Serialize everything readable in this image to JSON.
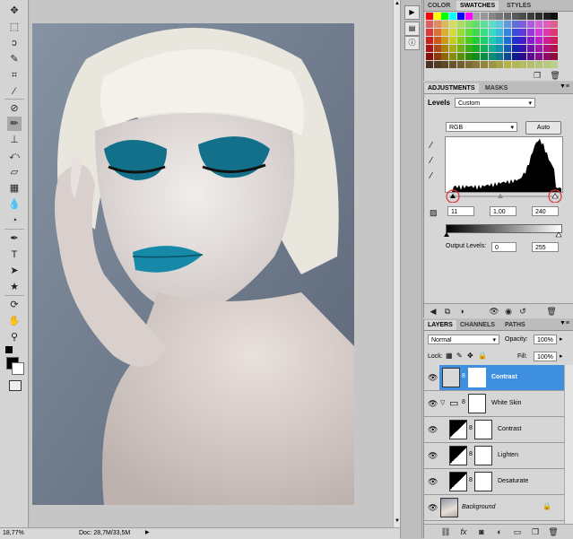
{
  "status": {
    "zoom": "18,77%",
    "doc": "Doc: 28,7M/33,5M"
  },
  "swatches_panel": {
    "tabs": [
      "COLOR",
      "SWATCHES",
      "STYLES"
    ]
  },
  "adjustments_panel": {
    "tabs": [
      "ADJUSTMENTS",
      "MASKS"
    ],
    "title": "Levels",
    "preset": "Custom",
    "channel": "RGB",
    "auto_label": "Auto",
    "input_levels": [
      "11",
      "1,00",
      "240"
    ],
    "output_label": "Output Levels:",
    "output_levels": [
      "0",
      "255"
    ]
  },
  "layers_panel": {
    "tabs": [
      "LAYERS",
      "CHANNELS",
      "PATHS"
    ],
    "blend_mode": "Normal",
    "opacity_label": "Opacity:",
    "opacity": "100%",
    "lock_label": "Lock:",
    "fill_label": "Fill:",
    "fill": "100%",
    "layers": [
      {
        "name": "Contrast",
        "selected": true
      },
      {
        "name": "White Skin"
      },
      {
        "name": "Contrast"
      },
      {
        "name": "Lighten"
      },
      {
        "name": "Desaturate"
      },
      {
        "name": "Background"
      }
    ]
  },
  "colors": {
    "accent": "#3f8fe0",
    "selected_layer": "#3f8fe0",
    "highlight_circle": "#e03030"
  }
}
